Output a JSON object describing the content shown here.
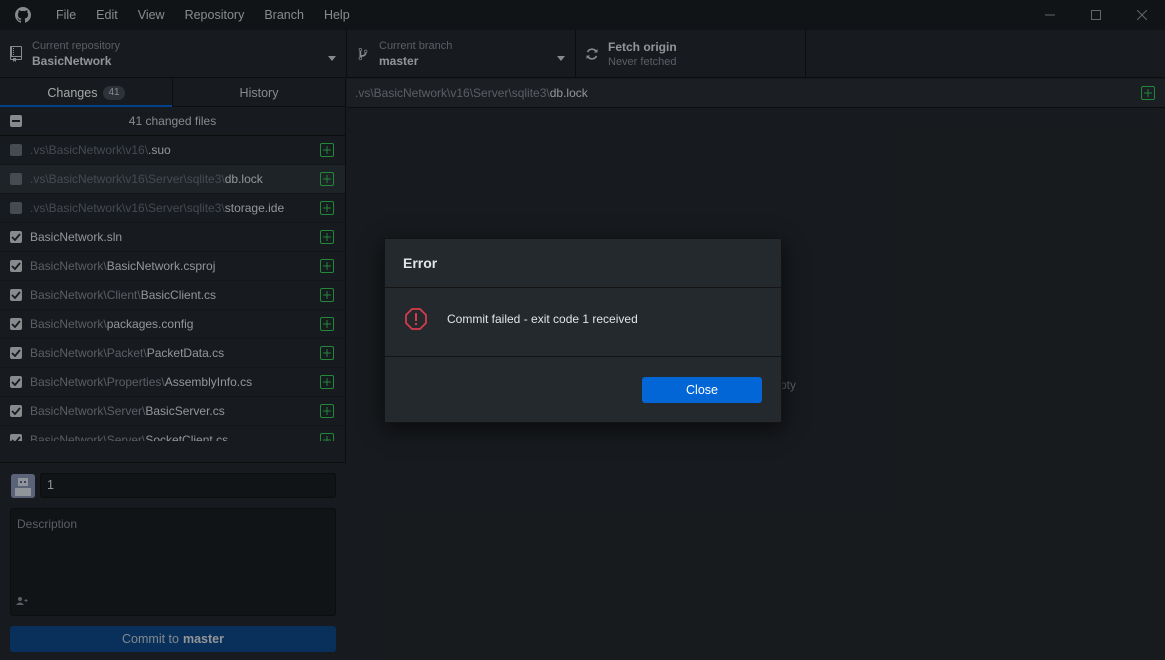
{
  "menu": [
    "File",
    "Edit",
    "View",
    "Repository",
    "Branch",
    "Help"
  ],
  "toolbar": {
    "repo_label": "Current repository",
    "repo_value": "BasicNetwork",
    "branch_label": "Current branch",
    "branch_value": "master",
    "fetch_label": "Fetch origin",
    "fetch_sub": "Never fetched"
  },
  "tabs": {
    "changes_label": "Changes",
    "changes_count": "41",
    "history_label": "History"
  },
  "files_header": "41 changed files",
  "files": [
    {
      "dir": ".vs\\BasicNetwork\\v16\\",
      "name": ".suo",
      "checked": false
    },
    {
      "dir": ".vs\\BasicNetwork\\v16\\Server\\sqlite3\\",
      "name": "db.lock",
      "checked": false
    },
    {
      "dir": ".vs\\BasicNetwork\\v16\\Server\\sqlite3\\",
      "name": "storage.ide",
      "checked": false
    },
    {
      "dir": "",
      "name": "BasicNetwork.sln",
      "checked": true
    },
    {
      "dir": "BasicNetwork\\",
      "name": "BasicNetwork.csproj",
      "checked": true
    },
    {
      "dir": "BasicNetwork\\Client\\",
      "name": "BasicClient.cs",
      "checked": true
    },
    {
      "dir": "BasicNetwork\\",
      "name": "packages.config",
      "checked": true
    },
    {
      "dir": "BasicNetwork\\Packet\\",
      "name": "PacketData.cs",
      "checked": true
    },
    {
      "dir": "BasicNetwork\\Properties\\",
      "name": "AssemblyInfo.cs",
      "checked": true
    },
    {
      "dir": "BasicNetwork\\Server\\",
      "name": "BasicServer.cs",
      "checked": true
    },
    {
      "dir": "BasicNetwork\\Server\\",
      "name": "SocketClient.cs",
      "checked": true
    }
  ],
  "commit": {
    "summary_value": "1",
    "description_placeholder": "Description",
    "button_prefix": "Commit to",
    "button_branch": "master"
  },
  "diff_header": {
    "dir": ".vs\\BasicNetwork\\v16\\Server\\sqlite3\\",
    "file": "db.lock"
  },
  "empty_text_fragment": "pty",
  "dialog": {
    "title": "Error",
    "message": "Commit failed - exit code 1 received",
    "close_label": "Close"
  },
  "colors": {
    "accent": "#0366d6",
    "error": "#d73a49",
    "added": "#34d058"
  }
}
